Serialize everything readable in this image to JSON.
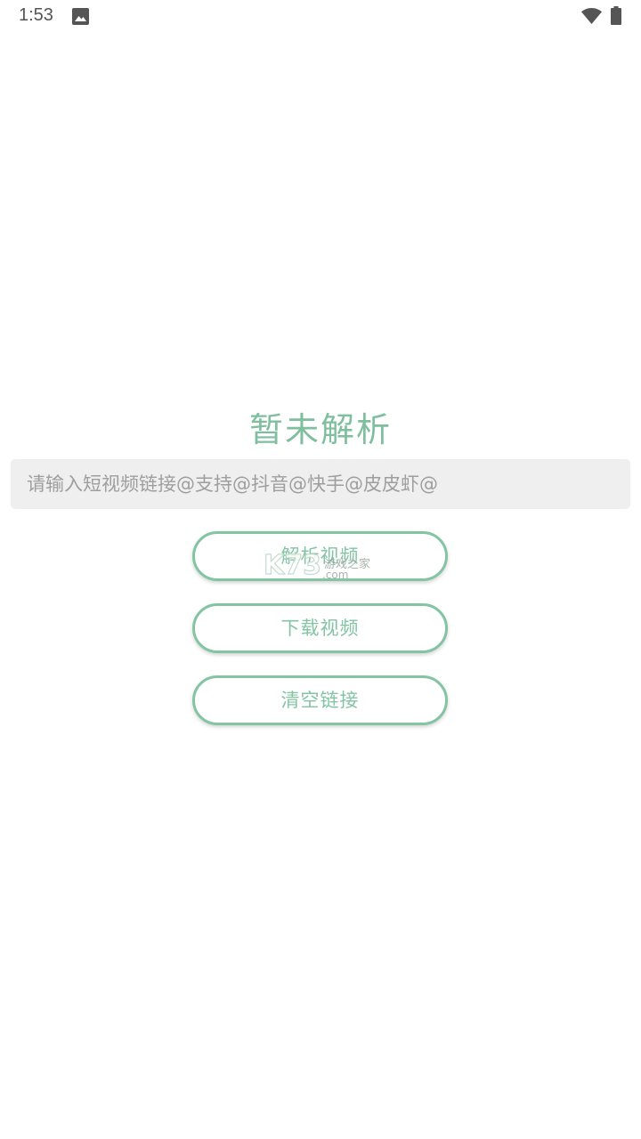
{
  "status_bar": {
    "time": "1:53",
    "icons": [
      "image-icon",
      "wifi-icon",
      "battery-icon"
    ]
  },
  "main": {
    "result_title": "暂未解析",
    "link_input": {
      "placeholder": "请输入短视频链接@支持@抖音@快手@皮皮虾@",
      "value": ""
    },
    "buttons": {
      "parse_label": "解析视频",
      "download_label": "下载视频",
      "clear_label": "清空链接"
    }
  },
  "watermark": {
    "brand": "K73",
    "caption": "游戏之家",
    "domain": ".com"
  },
  "colors": {
    "accent": "#83c4a3",
    "title": "#7fbf9d",
    "input_bg": "#efefef",
    "placeholder": "#9e9e9e",
    "status_icons": "#555555"
  }
}
